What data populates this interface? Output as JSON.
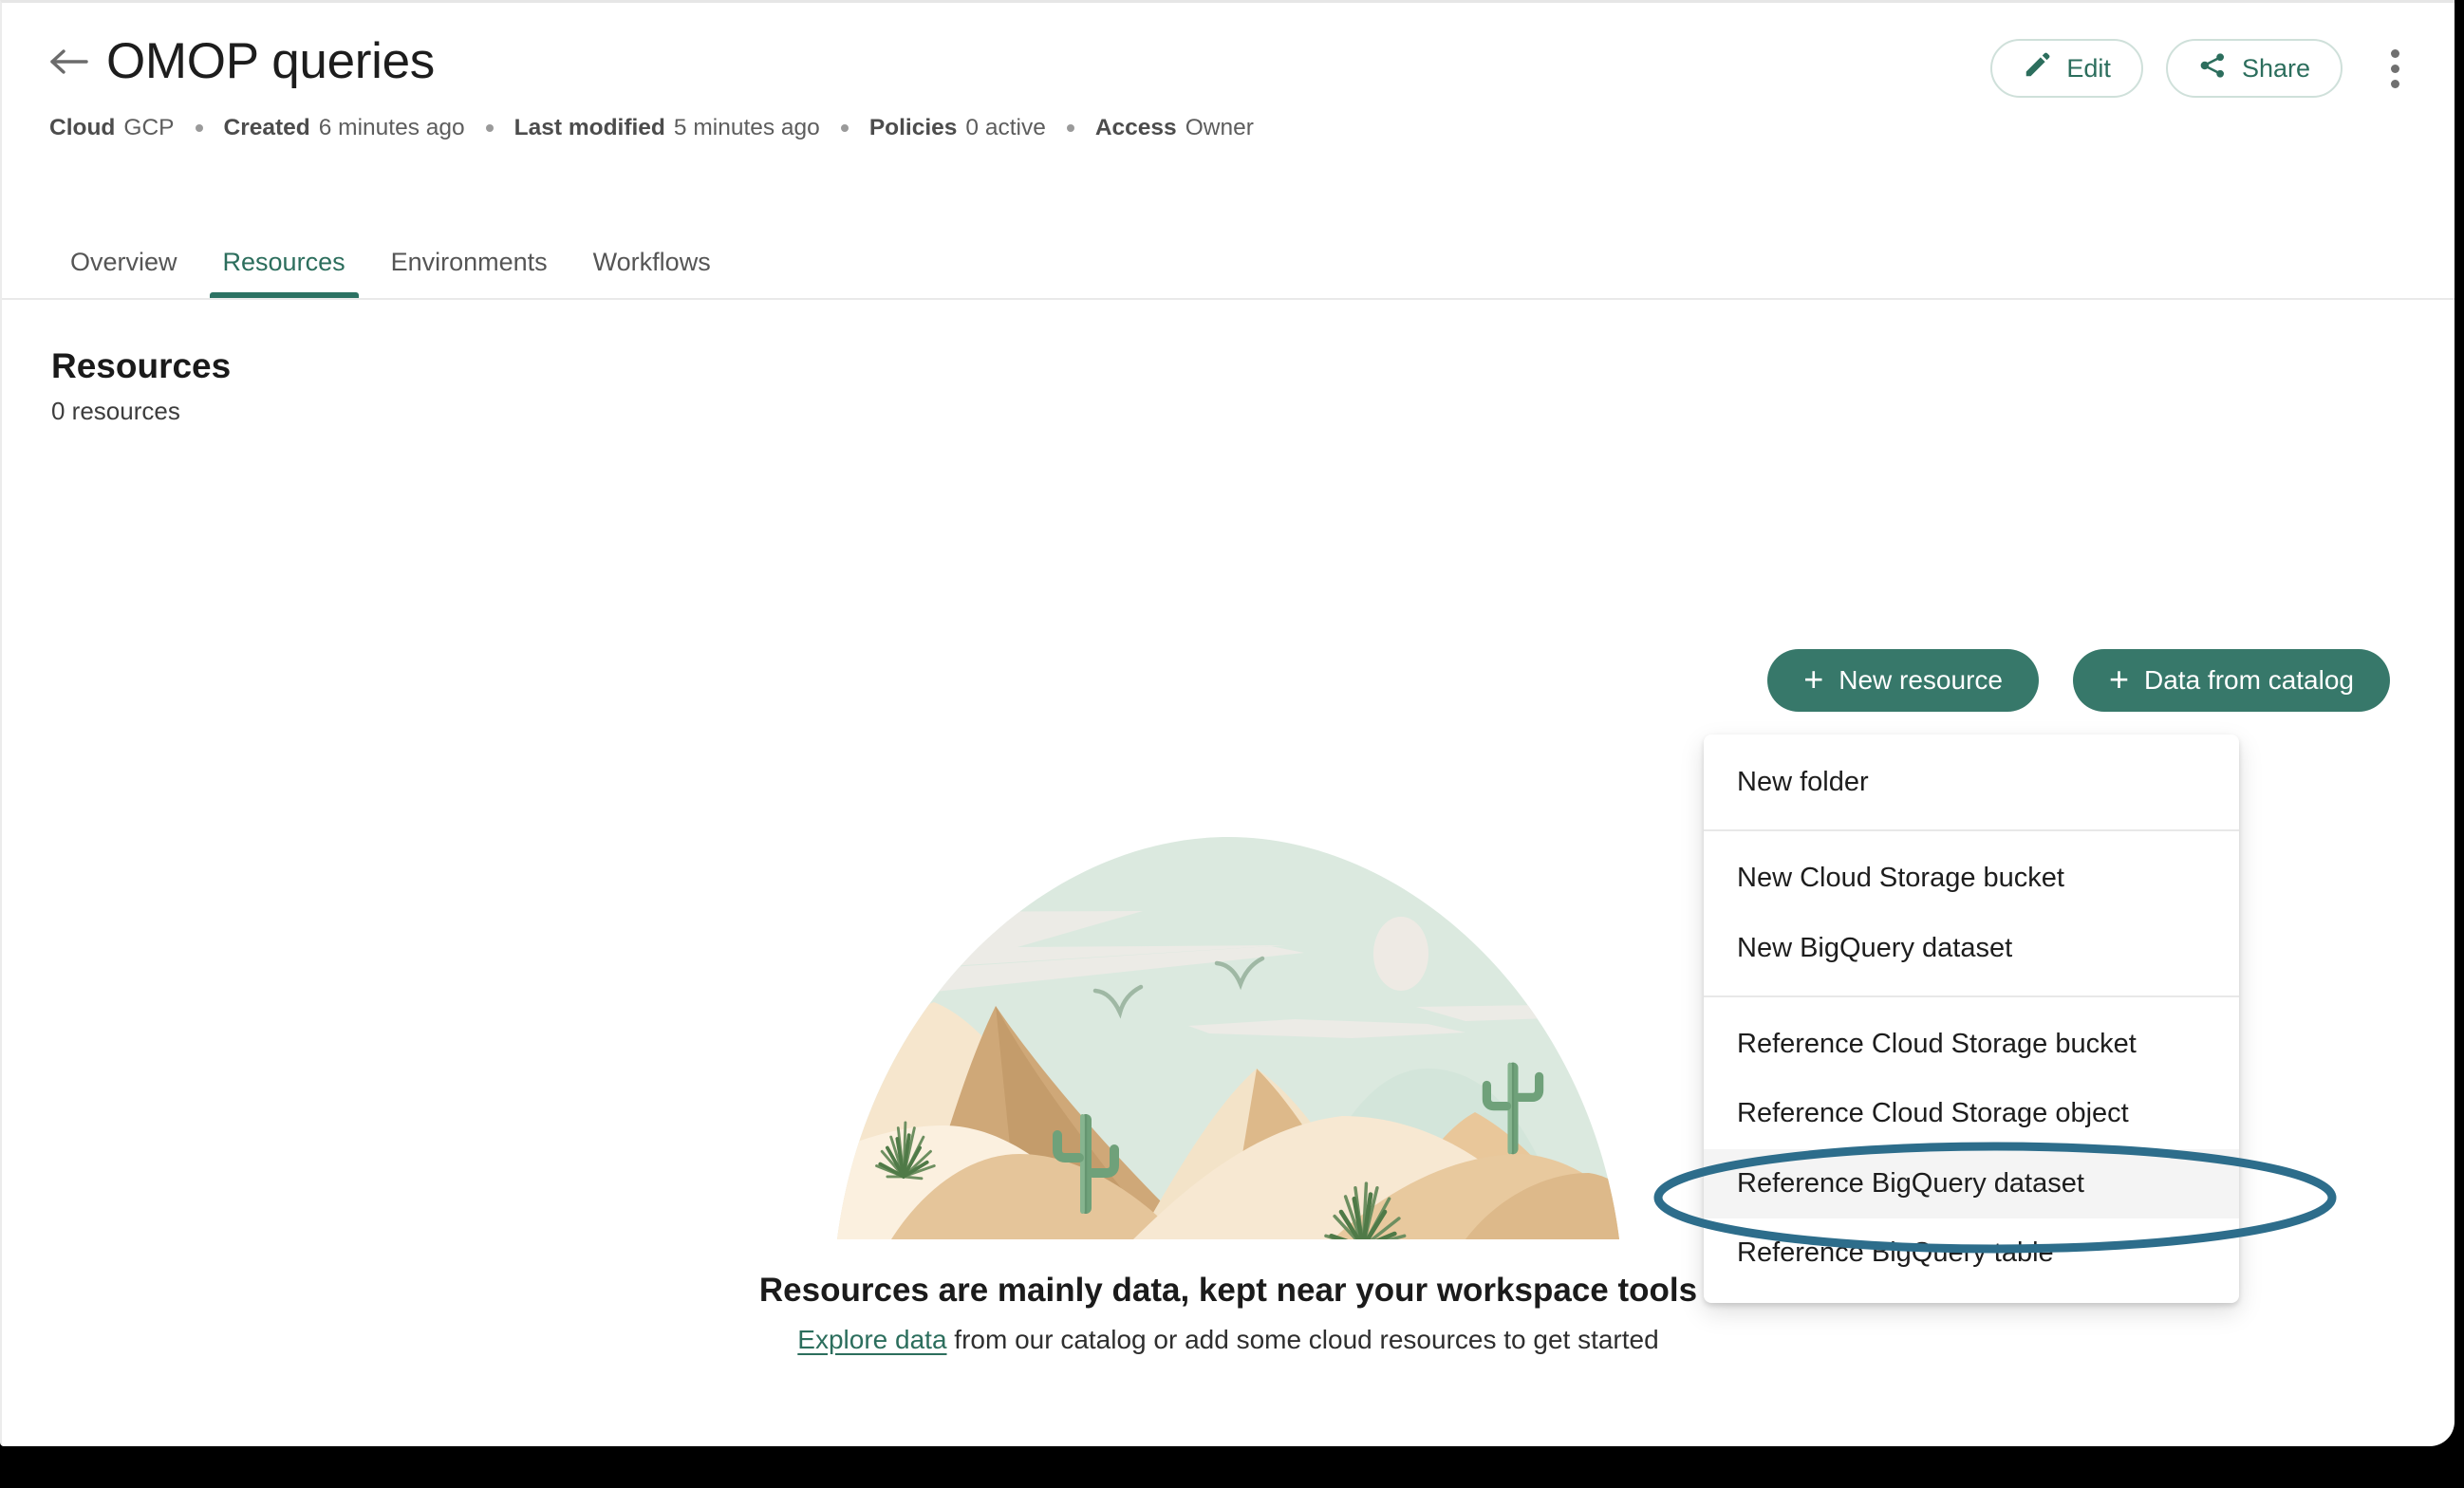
{
  "header": {
    "back_icon": "arrow-left-icon",
    "title": "OMOP queries",
    "meta": [
      {
        "key": "Cloud",
        "value": "GCP"
      },
      {
        "key": "Created",
        "value": "6 minutes ago"
      },
      {
        "key": "Last modified",
        "value": "5 minutes ago"
      },
      {
        "key": "Policies",
        "value": "0 active"
      },
      {
        "key": "Access",
        "value": "Owner"
      }
    ],
    "actions": {
      "edit_label": "Edit",
      "edit_icon": "pencil-icon",
      "share_label": "Share",
      "share_icon": "share-nodes-icon",
      "more_icon": "kebab-menu-icon"
    }
  },
  "tabs": [
    {
      "label": "Overview",
      "active": false
    },
    {
      "label": "Resources",
      "active": true
    },
    {
      "label": "Environments",
      "active": false
    },
    {
      "label": "Workflows",
      "active": false
    }
  ],
  "main": {
    "section_title": "Resources",
    "section_subtitle": "0 resources",
    "buttons": {
      "new_resource": "New resource",
      "data_from_catalog": "Data from catalog",
      "plus_icon": "plus-icon"
    },
    "empty_state": {
      "illustration": "desert-dunes-cacti-illustration",
      "title": "Resources are mainly data, kept near your workspace tools",
      "link_text": "Explore data",
      "rest_text": " from our catalog or add some cloud resources to get started"
    }
  },
  "menu": {
    "groups": [
      {
        "items": [
          {
            "label": "New folder",
            "hovered": false
          }
        ]
      },
      {
        "items": [
          {
            "label": "New Cloud Storage bucket",
            "hovered": false
          },
          {
            "label": "New BigQuery dataset",
            "hovered": false
          }
        ]
      },
      {
        "items": [
          {
            "label": "Reference Cloud Storage bucket",
            "hovered": false
          },
          {
            "label": "Reference Cloud Storage object",
            "hovered": false
          },
          {
            "label": "Reference BigQuery dataset",
            "hovered": true
          },
          {
            "label": "Reference BigQuery table",
            "hovered": false
          }
        ]
      }
    ]
  },
  "annotation": {
    "shape": "ellipse-highlight",
    "target": "Reference BigQuery dataset",
    "color": "#2d6d8b"
  },
  "colors": {
    "brand_green": "#37786a",
    "accent_green": "#2c6e5d",
    "tab_underline": "#2c7263",
    "annotation_blue": "#2d6d8b",
    "text_primary": "#1d1d1d",
    "text_muted": "#5d5d5d",
    "menu_hover": "#f4f4f4"
  }
}
